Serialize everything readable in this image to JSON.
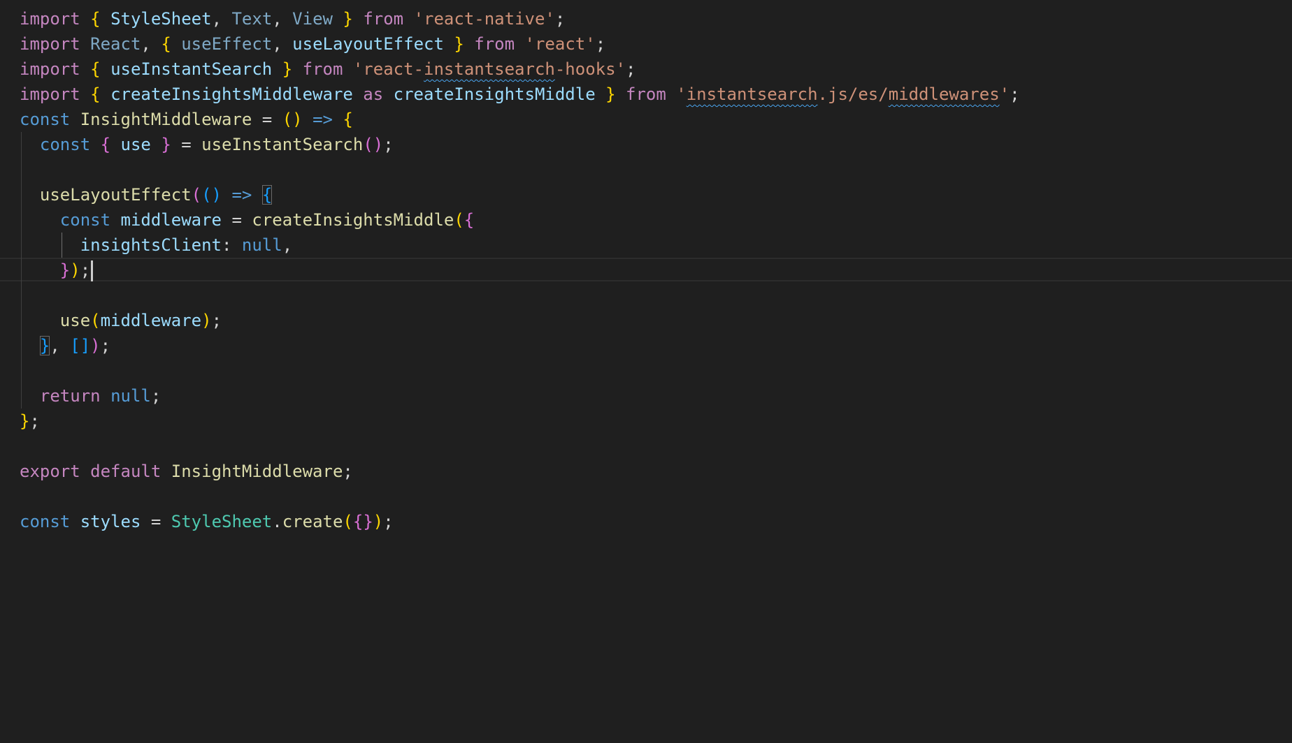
{
  "editor": {
    "colors": {
      "background": "#1f1f1f",
      "keyword": "#c586c0",
      "storage": "#569cd6",
      "function": "#dcdcaa",
      "variable": "#9cdcfe",
      "type": "#4ec9b0",
      "string": "#ce9178",
      "bracket_1": "#ffd700",
      "bracket_2": "#da70d6",
      "bracket_3": "#179fff",
      "squiggle": "#4aa5f0"
    },
    "cursor_line": 10,
    "lines": [
      {
        "tokens": [
          {
            "c": "kw",
            "t": "import"
          },
          {
            "c": "pn",
            "t": " "
          },
          {
            "c": "b1",
            "t": "{"
          },
          {
            "c": "pn",
            "t": " "
          },
          {
            "c": "vr",
            "t": "StyleSheet"
          },
          {
            "c": "pn",
            "t": ", "
          },
          {
            "c": "dim",
            "t": "Text"
          },
          {
            "c": "pn",
            "t": ", "
          },
          {
            "c": "dim",
            "t": "View"
          },
          {
            "c": "pn",
            "t": " "
          },
          {
            "c": "b1",
            "t": "}"
          },
          {
            "c": "pn",
            "t": " "
          },
          {
            "c": "kw",
            "t": "from"
          },
          {
            "c": "pn",
            "t": " "
          },
          {
            "c": "str",
            "t": "'react-native'"
          },
          {
            "c": "pn",
            "t": ";"
          }
        ]
      },
      {
        "tokens": [
          {
            "c": "kw",
            "t": "import"
          },
          {
            "c": "pn",
            "t": " "
          },
          {
            "c": "dim",
            "t": "React"
          },
          {
            "c": "pn",
            "t": ", "
          },
          {
            "c": "b1",
            "t": "{"
          },
          {
            "c": "pn",
            "t": " "
          },
          {
            "c": "dim",
            "t": "useEffect"
          },
          {
            "c": "pn",
            "t": ", "
          },
          {
            "c": "vr",
            "t": "useLayoutEffect"
          },
          {
            "c": "pn",
            "t": " "
          },
          {
            "c": "b1",
            "t": "}"
          },
          {
            "c": "pn",
            "t": " "
          },
          {
            "c": "kw",
            "t": "from"
          },
          {
            "c": "pn",
            "t": " "
          },
          {
            "c": "str",
            "t": "'react'"
          },
          {
            "c": "pn",
            "t": ";"
          }
        ]
      },
      {
        "tokens": [
          {
            "c": "kw",
            "t": "import"
          },
          {
            "c": "pn",
            "t": " "
          },
          {
            "c": "b1",
            "t": "{"
          },
          {
            "c": "pn",
            "t": " "
          },
          {
            "c": "vr",
            "t": "useInstantSearch"
          },
          {
            "c": "pn",
            "t": " "
          },
          {
            "c": "b1",
            "t": "}"
          },
          {
            "c": "pn",
            "t": " "
          },
          {
            "c": "kw",
            "t": "from"
          },
          {
            "c": "pn",
            "t": " "
          },
          {
            "c": "str",
            "t": "'react-"
          },
          {
            "c": "str squiggle",
            "t": "instantsearch"
          },
          {
            "c": "str",
            "t": "-hooks'"
          },
          {
            "c": "pn",
            "t": ";"
          }
        ]
      },
      {
        "tokens": [
          {
            "c": "kw",
            "t": "import"
          },
          {
            "c": "pn",
            "t": " "
          },
          {
            "c": "b1",
            "t": "{"
          },
          {
            "c": "pn",
            "t": " "
          },
          {
            "c": "vr",
            "t": "createInsightsMiddleware"
          },
          {
            "c": "pn",
            "t": " "
          },
          {
            "c": "kw",
            "t": "as"
          },
          {
            "c": "pn",
            "t": " "
          },
          {
            "c": "vr",
            "t": "createInsightsMiddle"
          },
          {
            "c": "pn",
            "t": " "
          },
          {
            "c": "b1",
            "t": "}"
          },
          {
            "c": "pn",
            "t": " "
          },
          {
            "c": "kw",
            "t": "from"
          },
          {
            "c": "pn",
            "t": " "
          },
          {
            "c": "str",
            "t": "'"
          },
          {
            "c": "str squiggle",
            "t": "instantsearch"
          },
          {
            "c": "str",
            "t": ".js/es/"
          },
          {
            "c": "str squiggle",
            "t": "middlewares"
          },
          {
            "c": "str",
            "t": "'"
          },
          {
            "c": "pn",
            "t": ";"
          }
        ]
      },
      {
        "tokens": [
          {
            "c": "st",
            "t": "const"
          },
          {
            "c": "pn",
            "t": " "
          },
          {
            "c": "fn",
            "t": "InsightMiddleware"
          },
          {
            "c": "pn",
            "t": " = "
          },
          {
            "c": "b1",
            "t": "()"
          },
          {
            "c": "pn",
            "t": " "
          },
          {
            "c": "st",
            "t": "=>"
          },
          {
            "c": "pn",
            "t": " "
          },
          {
            "c": "b1",
            "t": "{"
          }
        ]
      },
      {
        "tokens": [
          {
            "c": "pn",
            "t": "  "
          },
          {
            "c": "st",
            "t": "const"
          },
          {
            "c": "pn",
            "t": " "
          },
          {
            "c": "b2",
            "t": "{"
          },
          {
            "c": "pn",
            "t": " "
          },
          {
            "c": "vr",
            "t": "use"
          },
          {
            "c": "pn",
            "t": " "
          },
          {
            "c": "b2",
            "t": "}"
          },
          {
            "c": "pn",
            "t": " = "
          },
          {
            "c": "fn",
            "t": "useInstantSearch"
          },
          {
            "c": "b2",
            "t": "()"
          },
          {
            "c": "pn",
            "t": ";"
          }
        ]
      },
      {
        "tokens": []
      },
      {
        "tokens": [
          {
            "c": "pn",
            "t": "  "
          },
          {
            "c": "fn",
            "t": "useLayoutEffect"
          },
          {
            "c": "b2",
            "t": "("
          },
          {
            "c": "b3",
            "t": "()"
          },
          {
            "c": "pn",
            "t": " "
          },
          {
            "c": "st",
            "t": "=>"
          },
          {
            "c": "pn",
            "t": " "
          },
          {
            "c": "b3 bracket-box",
            "t": "{"
          }
        ]
      },
      {
        "tokens": [
          {
            "c": "pn",
            "t": "    "
          },
          {
            "c": "st",
            "t": "const"
          },
          {
            "c": "pn",
            "t": " "
          },
          {
            "c": "vr",
            "t": "middleware"
          },
          {
            "c": "pn",
            "t": " = "
          },
          {
            "c": "fn",
            "t": "createInsightsMiddle"
          },
          {
            "c": "b1",
            "t": "("
          },
          {
            "c": "b2",
            "t": "{"
          }
        ]
      },
      {
        "tokens": [
          {
            "c": "pn",
            "t": "      "
          },
          {
            "c": "vr",
            "t": "insightsClient"
          },
          {
            "c": "pn",
            "t": ": "
          },
          {
            "c": "st",
            "t": "null"
          },
          {
            "c": "pn",
            "t": ","
          }
        ]
      },
      {
        "tokens": [
          {
            "c": "pn",
            "t": "    "
          },
          {
            "c": "b2",
            "t": "}"
          },
          {
            "c": "b1",
            "t": ")"
          },
          {
            "c": "pn",
            "t": ";"
          }
        ]
      },
      {
        "tokens": []
      },
      {
        "tokens": [
          {
            "c": "pn",
            "t": "    "
          },
          {
            "c": "fn",
            "t": "use"
          },
          {
            "c": "b1",
            "t": "("
          },
          {
            "c": "vr",
            "t": "middleware"
          },
          {
            "c": "b1",
            "t": ")"
          },
          {
            "c": "pn",
            "t": ";"
          }
        ]
      },
      {
        "tokens": [
          {
            "c": "pn",
            "t": "  "
          },
          {
            "c": "b3 bracket-box",
            "t": "}"
          },
          {
            "c": "pn",
            "t": ", "
          },
          {
            "c": "b3",
            "t": "[]"
          },
          {
            "c": "b2",
            "t": ")"
          },
          {
            "c": "pn",
            "t": ";"
          }
        ]
      },
      {
        "tokens": []
      },
      {
        "tokens": [
          {
            "c": "pn",
            "t": "  "
          },
          {
            "c": "kw",
            "t": "return"
          },
          {
            "c": "pn",
            "t": " "
          },
          {
            "c": "st",
            "t": "null"
          },
          {
            "c": "pn",
            "t": ";"
          }
        ]
      },
      {
        "tokens": [
          {
            "c": "b1",
            "t": "}"
          },
          {
            "c": "pn",
            "t": ";"
          }
        ]
      },
      {
        "tokens": []
      },
      {
        "tokens": [
          {
            "c": "kw",
            "t": "export"
          },
          {
            "c": "pn",
            "t": " "
          },
          {
            "c": "kw",
            "t": "default"
          },
          {
            "c": "pn",
            "t": " "
          },
          {
            "c": "fn",
            "t": "InsightMiddleware"
          },
          {
            "c": "pn",
            "t": ";"
          }
        ]
      },
      {
        "tokens": []
      },
      {
        "tokens": [
          {
            "c": "st",
            "t": "const"
          },
          {
            "c": "pn",
            "t": " "
          },
          {
            "c": "vr",
            "t": "styles"
          },
          {
            "c": "pn",
            "t": " = "
          },
          {
            "c": "ty",
            "t": "StyleSheet"
          },
          {
            "c": "pn",
            "t": "."
          },
          {
            "c": "fn",
            "t": "create"
          },
          {
            "c": "b1",
            "t": "("
          },
          {
            "c": "b2",
            "t": "{}"
          },
          {
            "c": "b1",
            "t": ")"
          },
          {
            "c": "pn",
            "t": ";"
          }
        ]
      }
    ]
  }
}
